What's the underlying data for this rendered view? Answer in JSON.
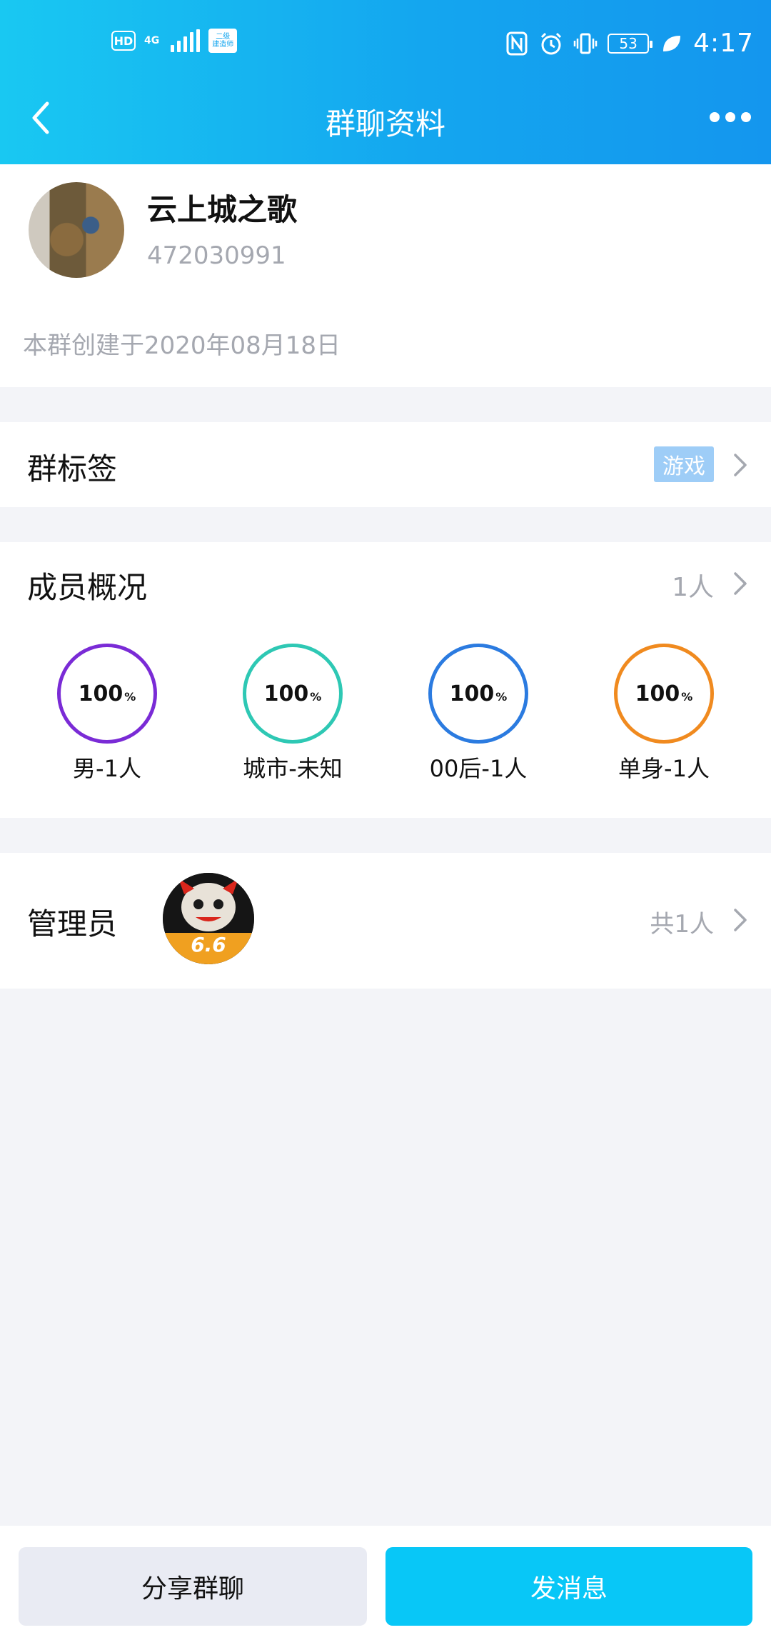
{
  "status_bar": {
    "hd": "HD",
    "network": "4G",
    "box_text": "二级\n建造师",
    "battery": "53",
    "time": "4:17"
  },
  "nav": {
    "title": "群聊资料"
  },
  "group": {
    "name": "云上城之歌",
    "id": "472030991",
    "created": "本群创建于2020年08月18日"
  },
  "tags": {
    "label": "群标签",
    "chip": "游戏"
  },
  "members": {
    "label": "成员概况",
    "count": "1人",
    "stats": [
      {
        "value": "100",
        "unit": "%",
        "label": "男-1人",
        "color": "#7a2bd6"
      },
      {
        "value": "100",
        "unit": "%",
        "label": "城市-未知",
        "color": "#2ec8b4"
      },
      {
        "value": "100",
        "unit": "%",
        "label": "00后-1人",
        "color": "#2b7be0"
      },
      {
        "value": "100",
        "unit": "%",
        "label": "单身-1人",
        "color": "#f08a1f"
      }
    ]
  },
  "admin": {
    "label": "管理员",
    "count": "共1人",
    "avatar_text": "6.6"
  },
  "actions": {
    "share": "分享群聊",
    "send": "发消息"
  }
}
